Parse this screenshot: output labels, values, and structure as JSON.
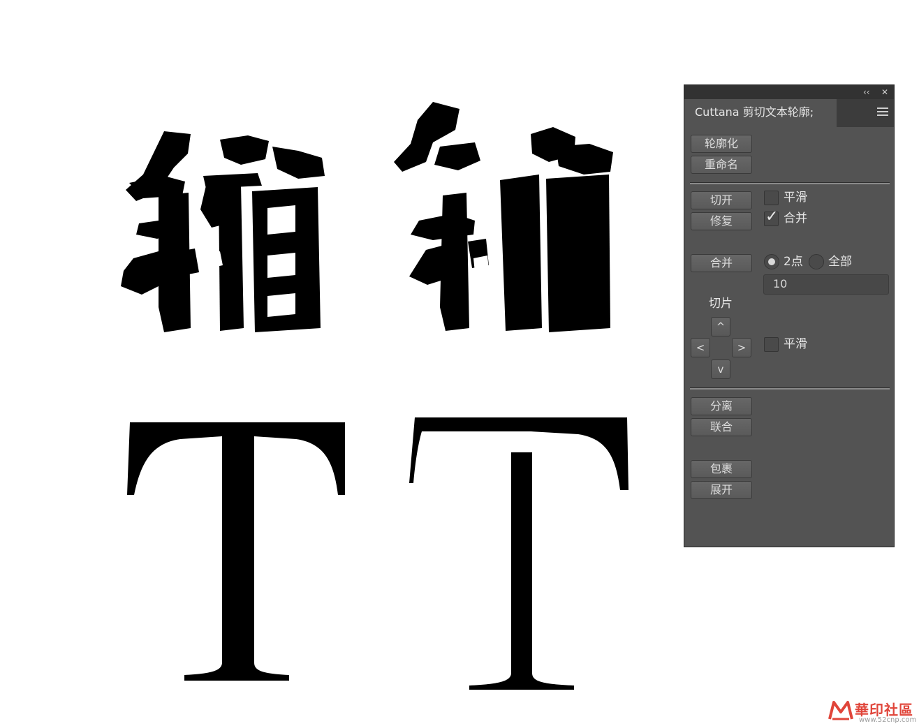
{
  "canvas": {
    "letter_left": "T",
    "letter_right": "T",
    "glyph_rough_left_icon": "brush-glyph-xiang",
    "glyph_rough_right_icon": "brush-glyph-xiang-cut"
  },
  "panel": {
    "title": "Cuttana 剪切文本轮廓;",
    "collapse_icon": "‹‹",
    "close_icon": "✕",
    "buttons": {
      "outline": "轮廓化",
      "rename": "重命名",
      "cut": "切开",
      "repair": "修复",
      "merge": "合并",
      "separate": "分离",
      "join": "联合",
      "wrap": "包裹",
      "expand": "展开"
    },
    "options": {
      "smooth_1": "平滑",
      "merge_check": "合并",
      "radio_2pt": "2点",
      "radio_all": "全部",
      "value": "10",
      "slice_label": "切片",
      "smooth_2": "平滑"
    },
    "arrows": {
      "up": "^",
      "left": "<",
      "right": ">",
      "down": "v"
    }
  },
  "watermark": {
    "text": "華印社區",
    "url": "www.52cnp.com"
  },
  "colors": {
    "panel_bg": "#535353",
    "topbar": "#323232",
    "accent": "#e0453a"
  }
}
